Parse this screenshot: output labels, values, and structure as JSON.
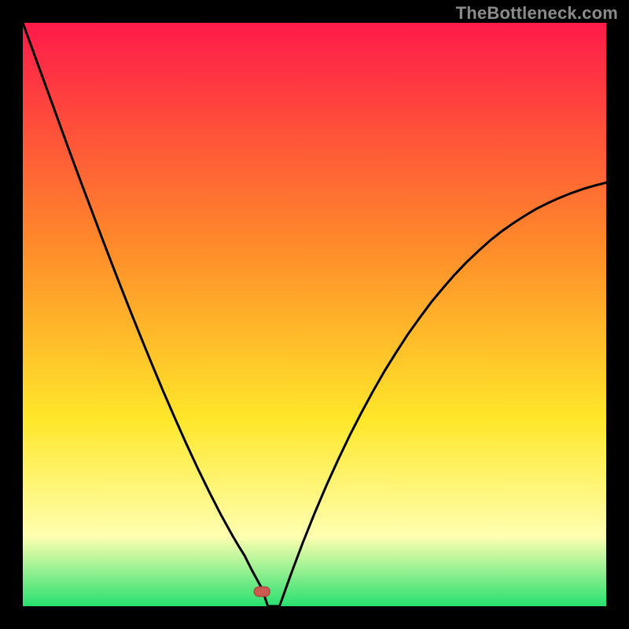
{
  "watermark": "TheBottleneck.com",
  "colors": {
    "gradient_top": "#ff1a4a",
    "gradient_mid1": "#ff8a2a",
    "gradient_mid2": "#ffe72a",
    "gradient_mid3": "#ffffb0",
    "gradient_bottom": "#28e070",
    "curve": "#000000",
    "marker_fill": "#cc5a50",
    "marker_stroke": "#b04a40",
    "frame": "#000000"
  },
  "chart_data": {
    "type": "line",
    "title": "",
    "xlabel": "",
    "ylabel": "",
    "xlim": [
      0,
      100
    ],
    "ylim": [
      0,
      100
    ],
    "grid": false,
    "legend": false,
    "x": [
      0,
      2,
      4,
      6,
      8,
      10,
      12,
      14,
      16,
      18,
      20,
      22,
      24,
      26,
      28,
      30,
      32,
      34,
      35,
      36,
      37,
      38,
      38.6,
      39.2,
      39.8,
      40.4,
      41,
      42,
      44,
      46,
      48,
      50,
      52,
      54,
      56,
      58,
      60,
      62,
      64,
      66,
      68,
      70,
      72,
      74,
      76,
      78,
      80,
      82,
      84,
      86,
      88,
      90,
      92,
      94,
      96,
      98,
      100
    ],
    "values": [
      100,
      94.5,
      89,
      83.5,
      78,
      72.6,
      67.3,
      62,
      56.8,
      51.7,
      46.7,
      41.8,
      37,
      32.4,
      27.9,
      23.6,
      19.5,
      15.6,
      13.8,
      12,
      10.3,
      8.7,
      7.5,
      6.3,
      5.2,
      4.1,
      3.0,
      0,
      0,
      5.6,
      10.9,
      15.9,
      20.6,
      25,
      29.2,
      33.1,
      36.8,
      40.3,
      43.5,
      46.6,
      49.4,
      52.1,
      54.5,
      56.8,
      58.9,
      60.8,
      62.6,
      64.2,
      65.6,
      66.9,
      68.1,
      69.1,
      70,
      70.8,
      71.5,
      72.1,
      72.6
    ],
    "minimum_marker": {
      "x": 41,
      "y": 2.5
    },
    "annotations": []
  }
}
